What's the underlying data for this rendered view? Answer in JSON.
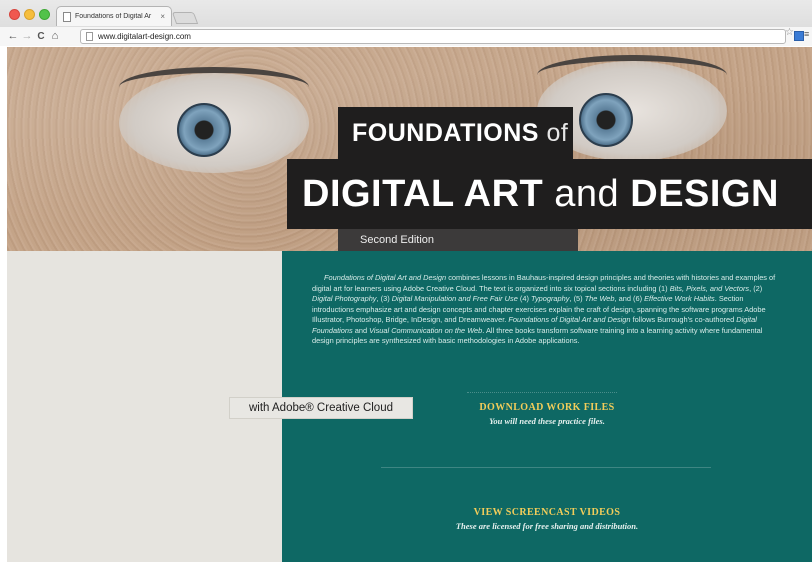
{
  "browser": {
    "tab_title": "Foundations of Digital Ar",
    "tab_close": "×",
    "url": "www.digitalart-design.com",
    "back": "←",
    "forward": "→",
    "reload": "C",
    "home": "⌂",
    "star": "☆",
    "menu": "≡"
  },
  "hero": {
    "title_foundations": "FOUNDATIONS",
    "title_of": "of",
    "title_digital_art": "DIGITAL ART",
    "title_and": "and",
    "title_design": "DESIGN",
    "edition": "Second Edition"
  },
  "description": {
    "p1": "Foundations of Digital Art and Design",
    "p2": " combines lessons in Bauhaus-inspired design principles and theories with histories and examples of digital art for learners using Adobe Creative Cloud. The text is organized into six topical sections including (1) ",
    "p3": "Bits, Pixels, and Vectors",
    "p4": ", (2) ",
    "p5": "Digital Photography",
    "p6": ", (3) ",
    "p7": "Digital Manipulation and Free Fair Use",
    "p8": " (4) ",
    "p9": "Typography",
    "p10": ", (5) ",
    "p11": "The Web",
    "p12": ", and (6) ",
    "p13": "Effective Work Habits",
    "p14": ". Section introductions emphasize art and design concepts and chapter exercises explain the craft of design, spanning the software programs Adobe Illustrator, Photoshop, Bridge, InDesign, and Dreamweaver. ",
    "p15": "Foundations of Digital Art and Design",
    "p16": " follows Burrough's co-authored ",
    "p17": "Digital Foundations",
    "p18": " and ",
    "p19": "Visual Communication on the Web",
    "p20": ". All three books transform software training into a learning activity where fundamental design principles are synthesized with basic methodologies in Adobe applications."
  },
  "badge": "with Adobe® Creative Cloud",
  "download": {
    "title": "DOWNLOAD WORK FILES",
    "subtitle": "You will need these practice files."
  },
  "screencast": {
    "title": "VIEW SCREENCAST VIDEOS",
    "subtitle": "These are licensed for free sharing and distribution."
  },
  "colors": {
    "teal": "#0e6864",
    "gold": "#f2cd5a",
    "title_bg": "#1f1e1e",
    "panel_light": "#e6e4df"
  }
}
